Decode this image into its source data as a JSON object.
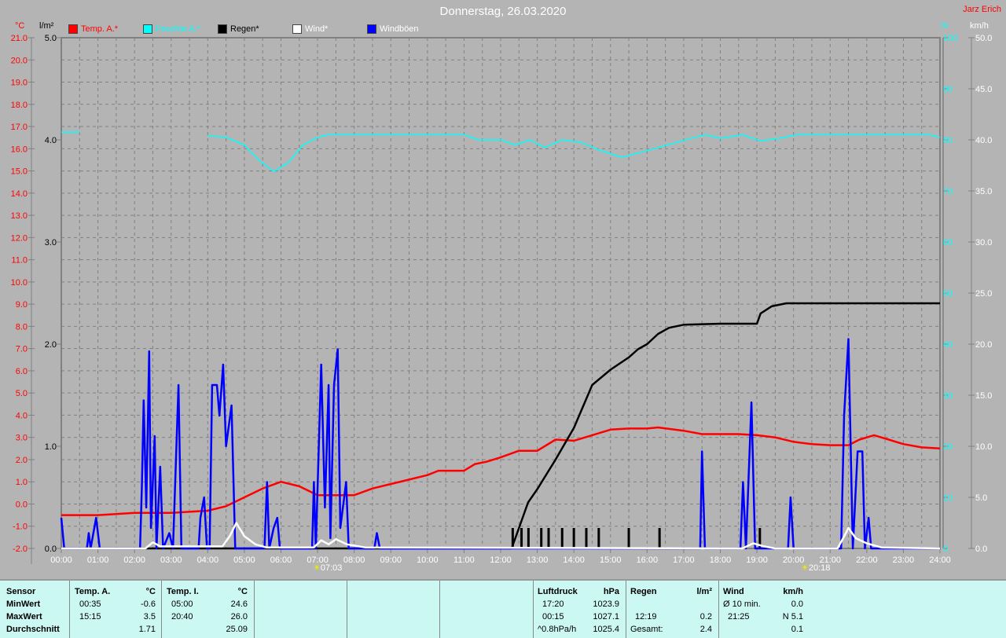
{
  "title": "Donnerstag, 26.03.2020",
  "author": "Jarz Erich",
  "legend": [
    {
      "label": "Temp. A.*",
      "color": "#ff0000"
    },
    {
      "label": "Feuchte A.*",
      "color": "#00ffff"
    },
    {
      "label": "Regen*",
      "color": "#000000"
    },
    {
      "label": "Wind*",
      "color": "#ffffff"
    },
    {
      "label": "Windböen",
      "color": "#0000ff"
    }
  ],
  "units": {
    "temp": "°C",
    "rain": "l/m²",
    "hum": "%",
    "wind": "km/h"
  },
  "sun": {
    "sunrise": "07:03",
    "sunset": "20:18"
  },
  "chart_data": {
    "type": "line",
    "title": "Donnerstag, 26.03.2020",
    "x_unit": "hour",
    "xlim": [
      0,
      24
    ],
    "x_ticks": [
      "00:00",
      "01:00",
      "02:00",
      "03:00",
      "04:00",
      "05:00",
      "06:00",
      "07:00",
      "08:00",
      "09:00",
      "10:00",
      "11:00",
      "12:00",
      "13:00",
      "14:00",
      "15:00",
      "16:00",
      "17:00",
      "18:00",
      "19:00",
      "20:00",
      "21:00",
      "22:00",
      "23:00",
      "24:00"
    ],
    "axes": {
      "temp": {
        "label": "°C",
        "range": [
          -2,
          21
        ],
        "ticks": [
          "-2.0",
          "-1.0",
          "0.0",
          "1.0",
          "2.0",
          "3.0",
          "4.0",
          "5.0",
          "6.0",
          "7.0",
          "8.0",
          "9.0",
          "10.0",
          "11.0",
          "12.0",
          "13.0",
          "14.0",
          "15.0",
          "16.0",
          "17.0",
          "18.0",
          "19.0",
          "20.0",
          "21.0"
        ]
      },
      "rain": {
        "label": "l/m²",
        "range": [
          0,
          5
        ],
        "ticks": [
          "0.0",
          "1.0",
          "2.0",
          "3.0",
          "4.0",
          "5.0"
        ]
      },
      "hum": {
        "label": "%",
        "range": [
          0,
          100
        ],
        "ticks": [
          "0",
          "10",
          "20",
          "30",
          "40",
          "50",
          "60",
          "70",
          "80",
          "90",
          "100"
        ]
      },
      "wind": {
        "label": "km/h",
        "range": [
          0,
          50
        ],
        "ticks": [
          "0.0",
          "5.0",
          "10.0",
          "15.0",
          "20.0",
          "25.0",
          "30.0",
          "35.0",
          "40.0",
          "45.0",
          "50.0"
        ]
      }
    },
    "grid": true,
    "series": [
      {
        "name": "Temp. A.*",
        "axis": "temp",
        "color": "#ff0000",
        "points": [
          [
            0,
            -0.5
          ],
          [
            1,
            -0.5
          ],
          [
            2,
            -0.4
          ],
          [
            3,
            -0.4
          ],
          [
            4,
            -0.3
          ],
          [
            4.5,
            -0.1
          ],
          [
            5,
            0.3
          ],
          [
            5.5,
            0.7
          ],
          [
            6,
            1.0
          ],
          [
            6.5,
            0.8
          ],
          [
            7,
            0.4
          ],
          [
            8,
            0.4
          ],
          [
            8.5,
            0.7
          ],
          [
            9,
            0.9
          ],
          [
            9.5,
            1.1
          ],
          [
            10,
            1.3
          ],
          [
            10.3,
            1.5
          ],
          [
            11,
            1.5
          ],
          [
            11.3,
            1.8
          ],
          [
            11.6,
            1.9
          ],
          [
            12,
            2.1
          ],
          [
            12.5,
            2.4
          ],
          [
            13,
            2.4
          ],
          [
            13.5,
            2.9
          ],
          [
            14,
            2.85
          ],
          [
            14.5,
            3.1
          ],
          [
            15,
            3.35
          ],
          [
            15.5,
            3.4
          ],
          [
            16,
            3.4
          ],
          [
            16.3,
            3.45
          ],
          [
            17,
            3.3
          ],
          [
            17.5,
            3.15
          ],
          [
            18.5,
            3.15
          ],
          [
            19,
            3.1
          ],
          [
            19.5,
            3.0
          ],
          [
            20,
            2.8
          ],
          [
            20.5,
            2.7
          ],
          [
            21,
            2.65
          ],
          [
            21.5,
            2.65
          ],
          [
            21.8,
            2.9
          ],
          [
            22.2,
            3.1
          ],
          [
            22.6,
            2.9
          ],
          [
            23,
            2.7
          ],
          [
            23.5,
            2.55
          ],
          [
            24,
            2.5
          ]
        ]
      },
      {
        "name": "Feuchte A.*",
        "axis": "hum",
        "color": "#00ffff",
        "segments": [
          [
            [
              0,
              81.5
            ],
            [
              0.5,
              81.5
            ]
          ],
          [
            [
              4,
              80.8
            ],
            [
              4.5,
              80.5
            ],
            [
              5,
              79
            ],
            [
              5.4,
              76
            ],
            [
              5.8,
              73.8
            ],
            [
              6.2,
              75.5
            ],
            [
              6.6,
              79
            ],
            [
              7,
              80.5
            ],
            [
              7.3,
              81
            ],
            [
              11,
              81
            ],
            [
              11.4,
              80
            ],
            [
              12,
              80
            ],
            [
              12.4,
              79
            ],
            [
              12.8,
              80
            ],
            [
              13.2,
              78.5
            ],
            [
              13.7,
              80
            ],
            [
              14.2,
              79.5
            ],
            [
              14.7,
              78
            ],
            [
              15.3,
              76.6
            ],
            [
              15.8,
              77.5
            ],
            [
              16.3,
              78.5
            ],
            [
              16.8,
              79.5
            ],
            [
              17.3,
              80.5
            ],
            [
              17.6,
              81
            ],
            [
              18,
              80.3
            ],
            [
              18.6,
              81
            ],
            [
              19.1,
              79.8
            ],
            [
              19.6,
              80.3
            ],
            [
              20.1,
              81
            ],
            [
              23.7,
              81
            ],
            [
              24,
              80.5
            ]
          ]
        ]
      },
      {
        "name": "Regen*",
        "axis": "rain",
        "color": "#000000",
        "points": [
          [
            0,
            0
          ],
          [
            12.3,
            0
          ],
          [
            12.5,
            0.2
          ],
          [
            12.75,
            0.45
          ],
          [
            13,
            0.58
          ],
          [
            13.5,
            0.87
          ],
          [
            14,
            1.18
          ],
          [
            14.5,
            1.6
          ],
          [
            15,
            1.75
          ],
          [
            15.5,
            1.87
          ],
          [
            15.75,
            1.95
          ],
          [
            16,
            2.0
          ],
          [
            16.3,
            2.1
          ],
          [
            16.6,
            2.16
          ],
          [
            17,
            2.19
          ],
          [
            18,
            2.2
          ],
          [
            19,
            2.2
          ],
          [
            19.1,
            2.3
          ],
          [
            19.4,
            2.37
          ],
          [
            19.8,
            2.4
          ],
          [
            24,
            2.4
          ]
        ]
      },
      {
        "name": "Regen bars",
        "axis": "rain",
        "color": "#000000",
        "bars": [
          [
            12.33,
            0.2
          ],
          [
            12.57,
            0.2
          ],
          [
            12.76,
            0.2
          ],
          [
            13.11,
            0.2
          ],
          [
            13.31,
            0.2
          ],
          [
            13.68,
            0.2
          ],
          [
            14.0,
            0.2
          ],
          [
            14.34,
            0.2
          ],
          [
            14.68,
            0.2
          ],
          [
            15.5,
            0.2
          ],
          [
            16.34,
            0.2
          ],
          [
            19.08,
            0.2
          ]
        ]
      },
      {
        "name": "Windböen",
        "axis": "wind",
        "color": "#0000ff",
        "points": [
          [
            0,
            3
          ],
          [
            0.08,
            0
          ],
          [
            0.7,
            0
          ],
          [
            0.75,
            1.5
          ],
          [
            0.8,
            0
          ],
          [
            0.95,
            3
          ],
          [
            1.05,
            0
          ],
          [
            2.15,
            0
          ],
          [
            2.2,
            6
          ],
          [
            2.25,
            14.5
          ],
          [
            2.32,
            4
          ],
          [
            2.4,
            19.3
          ],
          [
            2.45,
            2
          ],
          [
            2.55,
            11
          ],
          [
            2.6,
            0
          ],
          [
            2.7,
            8
          ],
          [
            2.78,
            0
          ],
          [
            2.95,
            1.5
          ],
          [
            3.05,
            0
          ],
          [
            3.2,
            16
          ],
          [
            3.28,
            0
          ],
          [
            3.75,
            0
          ],
          [
            3.8,
            3
          ],
          [
            3.9,
            5
          ],
          [
            3.98,
            0
          ],
          [
            4.05,
            0
          ],
          [
            4.12,
            16
          ],
          [
            4.25,
            16
          ],
          [
            4.32,
            13
          ],
          [
            4.42,
            18
          ],
          [
            4.5,
            10
          ],
          [
            4.65,
            14
          ],
          [
            4.75,
            0
          ],
          [
            5.55,
            0
          ],
          [
            5.62,
            6.5
          ],
          [
            5.68,
            0
          ],
          [
            5.8,
            2
          ],
          [
            5.9,
            3
          ],
          [
            5.97,
            0
          ],
          [
            6.85,
            0
          ],
          [
            6.9,
            6.5
          ],
          [
            6.95,
            0
          ],
          [
            7.1,
            18
          ],
          [
            7.2,
            4
          ],
          [
            7.3,
            16
          ],
          [
            7.35,
            1
          ],
          [
            7.45,
            16
          ],
          [
            7.55,
            19.5
          ],
          [
            7.62,
            2
          ],
          [
            7.78,
            6.5
          ],
          [
            7.85,
            0
          ],
          [
            8.55,
            0
          ],
          [
            8.62,
            1.5
          ],
          [
            8.7,
            0
          ],
          [
            17.45,
            0
          ],
          [
            17.5,
            9.5
          ],
          [
            17.58,
            0
          ],
          [
            18.55,
            0
          ],
          [
            18.62,
            6.5
          ],
          [
            18.7,
            0
          ],
          [
            18.85,
            14.3
          ],
          [
            18.95,
            0
          ],
          [
            19.85,
            0
          ],
          [
            19.92,
            5
          ],
          [
            20,
            0
          ],
          [
            21.3,
            0
          ],
          [
            21.38,
            13
          ],
          [
            21.5,
            20.5
          ],
          [
            21.62,
            0
          ],
          [
            21.75,
            9.5
          ],
          [
            21.88,
            9.5
          ],
          [
            21.95,
            0
          ],
          [
            22.05,
            3
          ],
          [
            22.12,
            0
          ],
          [
            24,
            0
          ]
        ]
      },
      {
        "name": "Wind*",
        "axis": "wind",
        "color": "#ffffff",
        "points": [
          [
            0,
            0
          ],
          [
            2.3,
            0
          ],
          [
            2.5,
            0.6
          ],
          [
            2.7,
            0.2
          ],
          [
            4.4,
            0.2
          ],
          [
            4.6,
            1.2
          ],
          [
            4.78,
            2.5
          ],
          [
            5,
            1.2
          ],
          [
            5.3,
            0.4
          ],
          [
            5.6,
            0.1
          ],
          [
            6.9,
            0.1
          ],
          [
            7.1,
            0.8
          ],
          [
            7.3,
            0.4
          ],
          [
            7.5,
            0.9
          ],
          [
            7.8,
            0.4
          ],
          [
            8.3,
            0.1
          ],
          [
            18.6,
            0
          ],
          [
            18.9,
            0.5
          ],
          [
            19.2,
            0.2
          ],
          [
            19.5,
            0
          ],
          [
            21.2,
            0
          ],
          [
            21.4,
            1.3
          ],
          [
            21.5,
            2
          ],
          [
            21.7,
            1
          ],
          [
            22,
            0.5
          ],
          [
            22.4,
            0.1
          ],
          [
            24,
            0
          ]
        ]
      }
    ]
  },
  "stats": {
    "sensor": {
      "header": "Sensor",
      "rows": [
        "MinWert",
        "MaxWert",
        "Durchschnitt"
      ]
    },
    "temp_a": {
      "header": "Temp. A.",
      "unit": "°C",
      "min_time": "00:35",
      "min": "-0.6",
      "max_time": "15:15",
      "max": "3.5",
      "avg": "1.71"
    },
    "temp_i": {
      "header": "Temp. I.",
      "unit": "°C",
      "min_time": "05:00",
      "min": "24.6",
      "max_time": "20:40",
      "max": "26.0",
      "avg": "25.09"
    },
    "pressure": {
      "header": "Luftdruck",
      "unit": "hPa",
      "min_time": "17:20",
      "min": "1023.9",
      "max_time": "00:15",
      "max": "1027.1",
      "trend": "^0.8hPa/h",
      "avg": "1025.4"
    },
    "rain": {
      "header": "Regen",
      "unit": "l/m²",
      "max_time": "12:19",
      "max": "0.2",
      "total_label": "Gesamt:",
      "total": "2.4"
    },
    "wind": {
      "header": "Wind",
      "unit": "km/h",
      "avg_label": "Ø 10 min.",
      "avg": "0.0",
      "max_time": "21:25",
      "max": "N 5.1",
      "mean": "0.1"
    }
  }
}
